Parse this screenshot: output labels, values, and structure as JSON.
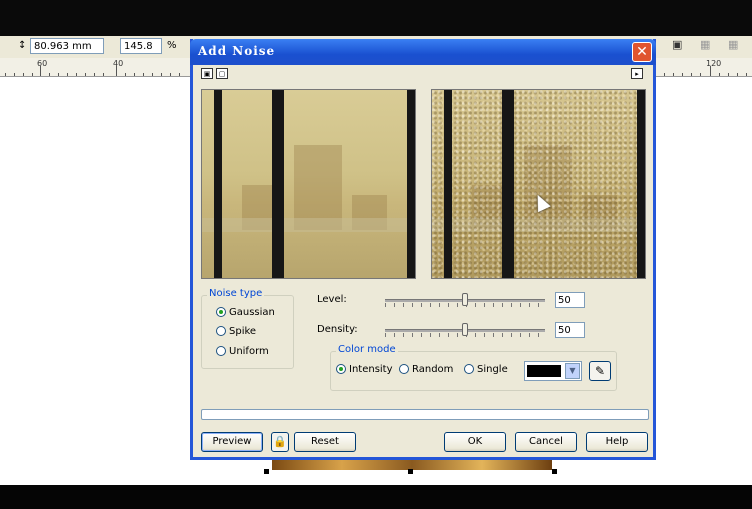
{
  "property_bar": {
    "width_value": "80.963 mm",
    "scale_value": "145.8",
    "scale_unit": "%"
  },
  "ruler": {
    "labels": [
      "60",
      "40",
      "120"
    ]
  },
  "dialog": {
    "title": "Add Noise",
    "close_glyph": "✕",
    "noise_type": {
      "label": "Noise type",
      "options": [
        "Gaussian",
        "Spike",
        "Uniform"
      ],
      "selected": "Gaussian"
    },
    "level": {
      "label": "Level:",
      "value": "50"
    },
    "density": {
      "label": "Density:",
      "value": "50"
    },
    "color_mode": {
      "label": "Color mode",
      "options": [
        "Intensity",
        "Random",
        "Single"
      ],
      "selected": "Intensity",
      "swatch_color": "#000000"
    },
    "buttons": {
      "preview": "Preview",
      "reset": "Reset",
      "ok": "OK",
      "cancel": "Cancel",
      "help": "Help"
    }
  },
  "colors": {
    "titlebar": "#1d4fcc",
    "dialog_bg": "#ece9d8",
    "group_label": "#0046d5"
  }
}
